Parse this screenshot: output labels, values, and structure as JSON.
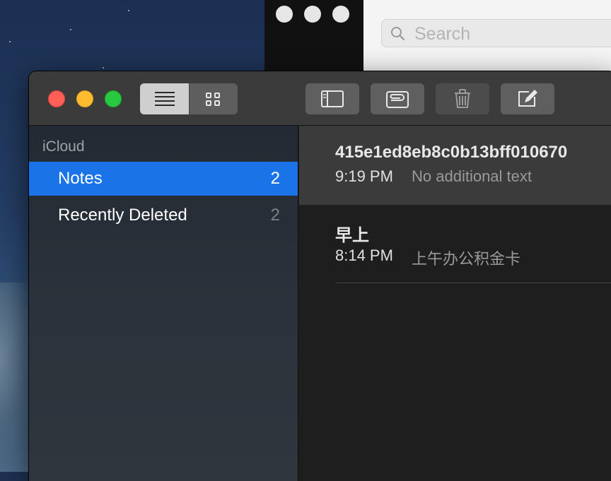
{
  "background_window": {
    "search": {
      "placeholder": "Search",
      "icon": "magnifier-icon"
    }
  },
  "window": {
    "traffic_lights": {
      "close_color": "#ff5f57",
      "minimize_color": "#febc2e",
      "zoom_color": "#28c840"
    },
    "toolbar": {
      "list_view_icon": "list-view-icon",
      "gallery_view_icon": "gallery-view-icon",
      "sidebar_toggle_icon": "sidebar-toggle-icon",
      "attachments_icon": "attachments-icon",
      "delete_icon": "trash-icon",
      "compose_icon": "compose-icon"
    }
  },
  "sidebar": {
    "section": "iCloud",
    "items": [
      {
        "label": "Notes",
        "count": "2",
        "selected": true
      },
      {
        "label": "Recently Deleted",
        "count": "2",
        "selected": false
      }
    ],
    "selection_color": "#1b73e8"
  },
  "notes": [
    {
      "title": "415e1ed8eb8c0b13bff010670",
      "time": "9:19 PM",
      "preview": "No additional text",
      "selected": true
    },
    {
      "title": "早上",
      "time": "8:14 PM",
      "preview": "上午办公积金卡",
      "selected": false
    }
  ]
}
